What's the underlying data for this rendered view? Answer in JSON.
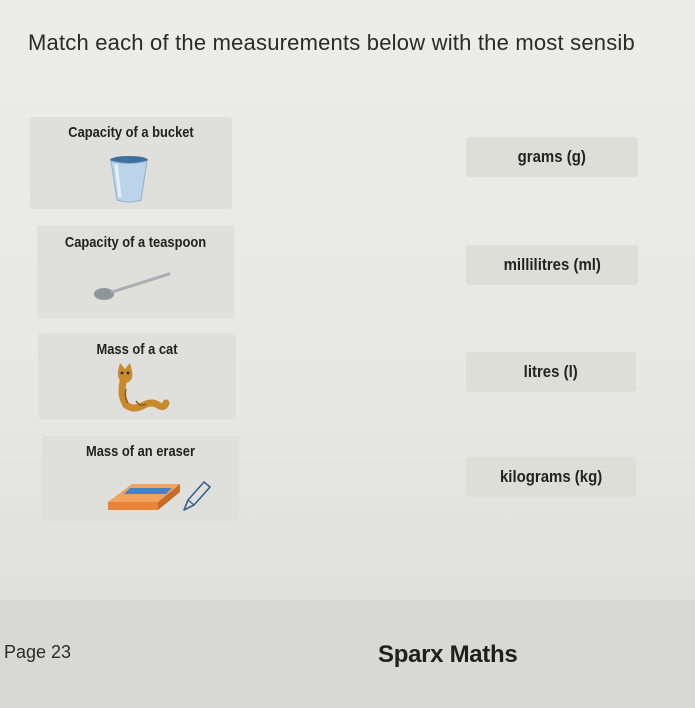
{
  "question": "Match each of the measurements below with the most sensib",
  "cards": [
    {
      "label": "Capacity of a bucket",
      "icon": "bucket-icon"
    },
    {
      "label": "Capacity of a teaspoon",
      "icon": "teaspoon-icon"
    },
    {
      "label": "Mass of a cat",
      "icon": "cat-icon"
    },
    {
      "label": "Mass of an eraser",
      "icon": "eraser-icon"
    }
  ],
  "units": [
    {
      "label": "grams (g)"
    },
    {
      "label": "millilitres (ml)"
    },
    {
      "label": "litres (l)"
    },
    {
      "label": "kilograms (kg)"
    }
  ],
  "footer": {
    "page": "Page  23",
    "brand": "Sparx Maths"
  },
  "colors": {
    "bucket_blue": "#6a9bc7",
    "cat_orange": "#c98a2c",
    "eraser_orange": "#e8843a",
    "eraser_blue": "#4a7fc1"
  }
}
